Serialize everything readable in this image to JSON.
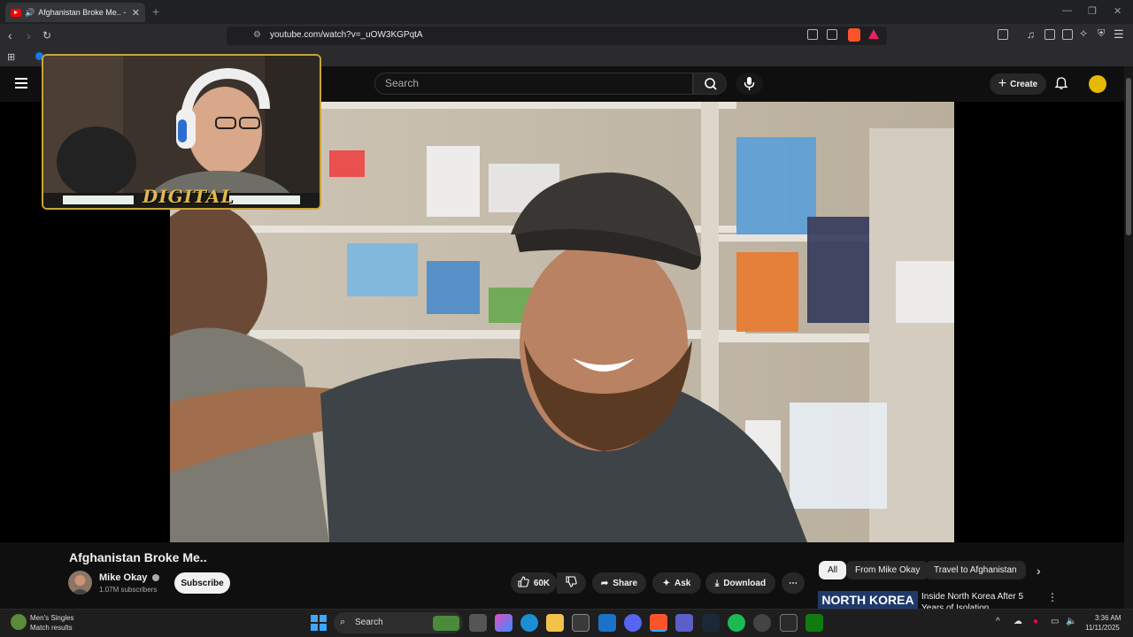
{
  "browser": {
    "tab_title": "Afghanistan Broke Me.. - You",
    "url": "youtube.com/watch?v=_uOW3KGPqtA"
  },
  "youtube": {
    "search_placeholder": "Search",
    "create_label": "Create",
    "overlay_logo_text": "DIGITAL"
  },
  "video": {
    "title": "Afghanistan Broke Me..",
    "channel_name": "Mike Okay",
    "subscribers": "1.07M subscribers",
    "subscribe_label": "Subscribe",
    "like_count": "60K",
    "share_label": "Share",
    "ask_label": "Ask",
    "download_label": "Download"
  },
  "chips": [
    "All",
    "From Mike Okay",
    "Travel to Afghanistan"
  ],
  "recommendation": {
    "thumb_text": "NORTH KOREA",
    "title": "Inside North Korea After 5 Years of Isolation"
  },
  "taskbar": {
    "search_label": "Search",
    "notification_title": "Men's Singles",
    "notification_sub": "Match results",
    "time": "3:36 AM",
    "date": "11/11/2025"
  },
  "colors": {
    "youtube_red": "#ff0000",
    "background": "#0f0f0f",
    "overlay_border": "#c9a437"
  }
}
